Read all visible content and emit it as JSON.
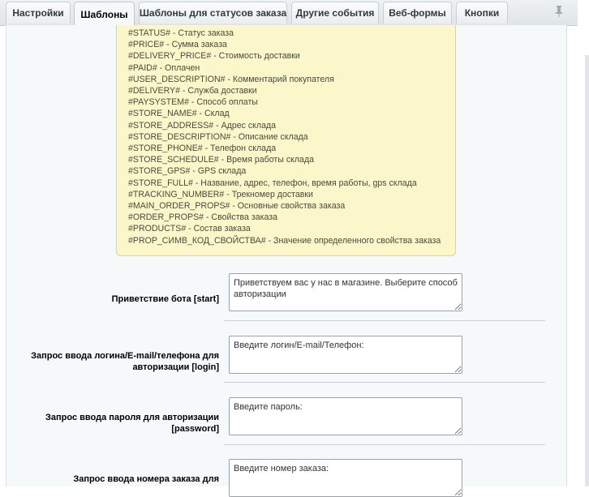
{
  "tabs": [
    {
      "label": "Настройки",
      "active": false
    },
    {
      "label": "Шаблоны",
      "active": true
    },
    {
      "label": "Шаблоны для статусов заказа",
      "active": false
    },
    {
      "label": "Другие события",
      "active": false
    },
    {
      "label": "Веб-формы",
      "active": false
    },
    {
      "label": "Кнопки",
      "active": false
    }
  ],
  "pin_icon": "pin-icon",
  "hint_lines": [
    "#STATUS# - Статус заказа",
    "#PRICE# - Сумма заказа",
    "#DELIVERY_PRICE# - Стоимость доставки",
    "#PAID# - Оплачен",
    "#USER_DESCRIPTION# - Комментарий покупателя",
    "#DELIVERY# - Служба доставки",
    "#PAYSYSTEM# - Способ оплаты",
    "#STORE_NAME# - Склад",
    "#STORE_ADDRESS# - Адрес склада",
    "#STORE_DESCRIPTION# - Описание склада",
    "#STORE_PHONE# - Телефон склада",
    "#STORE_SCHEDULE# - Время работы склада",
    "#STORE_GPS# - GPS склада",
    "#STORE_FULL# - Название, адрес, телефон, время работы, gps склада",
    "#TRACKING_NUMBER# - Трекномер доставки",
    "#MAIN_ORDER_PROPS# - Основные свойства заказа",
    "#ORDER_PROPS# - Свойства заказа",
    "#PRODUCTS# - Состав заказа",
    "#PROP_СИМВ_КОД_СВОЙСТВА# - Значение определенного свойства заказа"
  ],
  "fields": [
    {
      "label_lines": [
        "Приветствие бота [start]"
      ],
      "value": "Приветствуем вас у нас в магазине. Выберите способ авторизации"
    },
    {
      "label_lines": [
        "Запрос ввода логина/E-mail/телефона для",
        "авторизации [login]"
      ],
      "value": "Введите логин/E-mail/Телефон:"
    },
    {
      "label_lines": [
        "Запрос ввода пароля для авторизации",
        "[password]"
      ],
      "value": "Введите пароль:"
    },
    {
      "label_lines": [
        "Запрос ввода номера заказа для"
      ],
      "value": "Введите номер заказа:"
    }
  ]
}
